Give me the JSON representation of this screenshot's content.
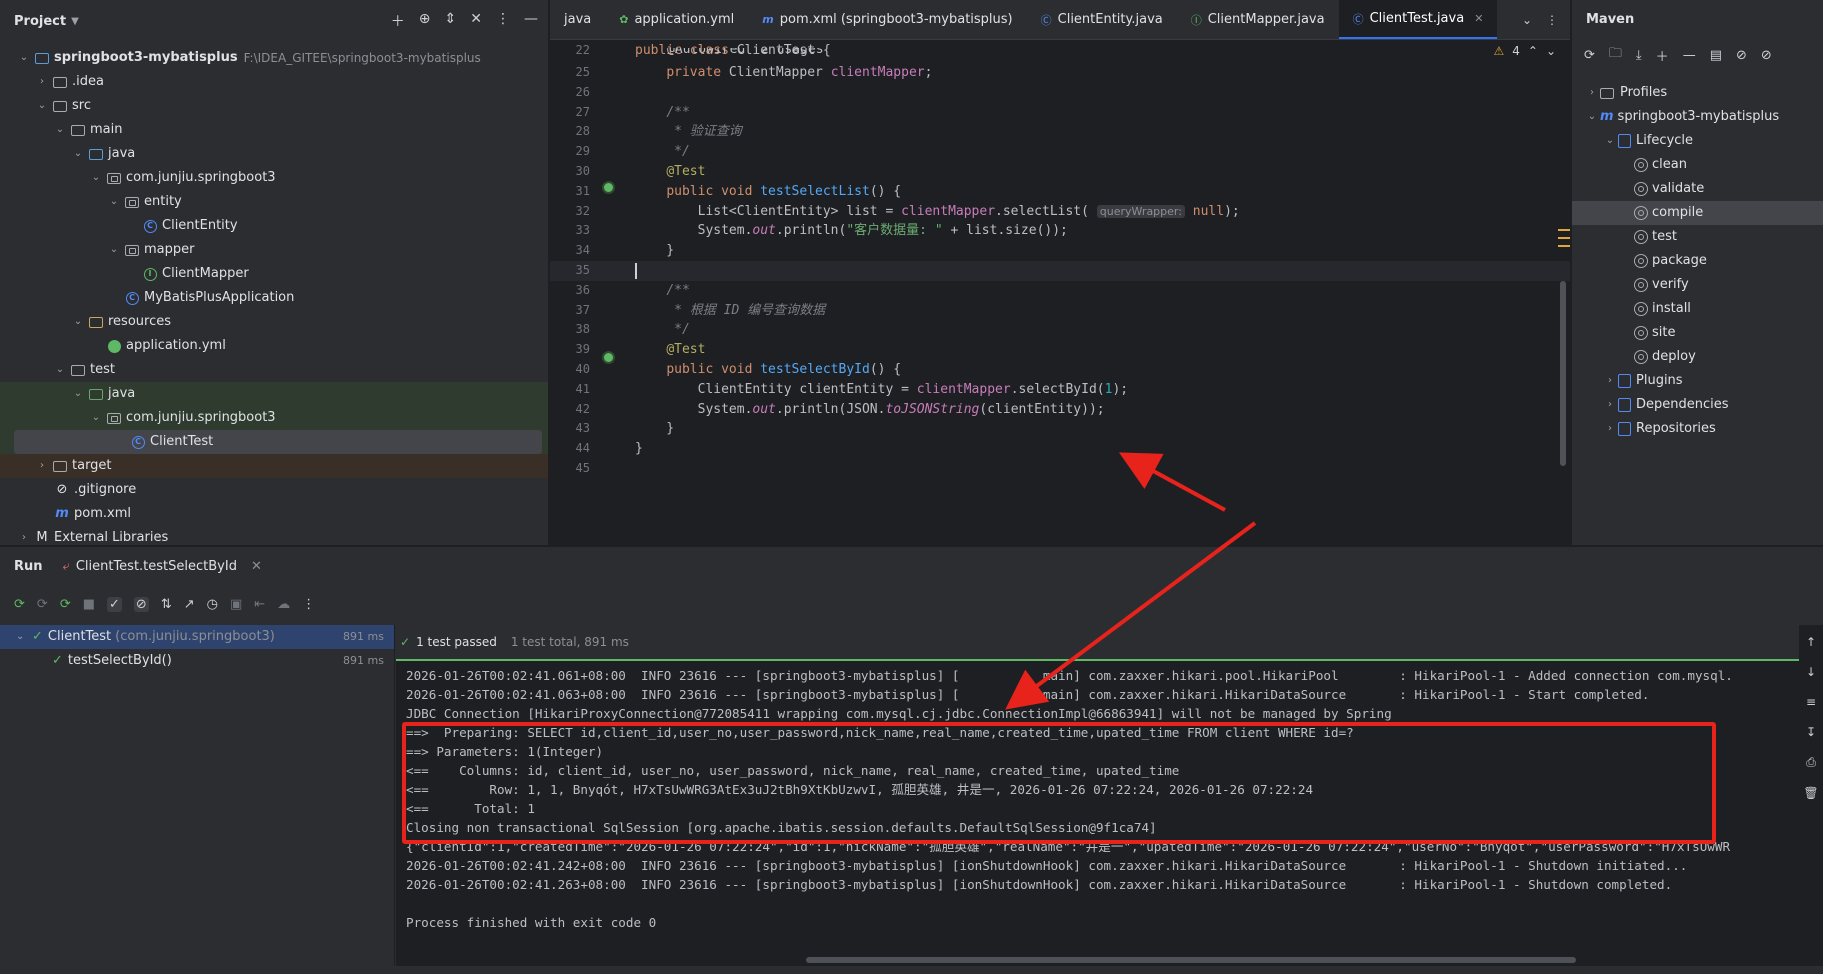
{
  "project": {
    "title": "Project",
    "tree": [
      {
        "label": "springboot3-mybatisplus",
        "path": "F:\\IDEA_GITEE\\springboot3-mybatisplus"
      },
      {
        "label": ".idea"
      },
      {
        "label": "src"
      },
      {
        "label": "main"
      },
      {
        "label": "java"
      },
      {
        "label": "com.junjiu.springboot3"
      },
      {
        "label": "entity"
      },
      {
        "label": "ClientEntity"
      },
      {
        "label": "mapper"
      },
      {
        "label": "ClientMapper"
      },
      {
        "label": "MyBatisPlusApplication"
      },
      {
        "label": "resources"
      },
      {
        "label": "application.yml"
      },
      {
        "label": "test"
      },
      {
        "label": "java"
      },
      {
        "label": "com.junjiu.springboot3"
      },
      {
        "label": "ClientTest"
      },
      {
        "label": "target"
      },
      {
        "label": ".gitignore"
      },
      {
        "label": "pom.xml"
      },
      {
        "label": "External Libraries"
      }
    ]
  },
  "editor": {
    "tabs": [
      {
        "label": "java"
      },
      {
        "label": "application.yml"
      },
      {
        "label": "pom.xml (springboot3-mybatisplus)"
      },
      {
        "label": "ClientEntity.java"
      },
      {
        "label": "ClientMapper.java"
      },
      {
        "label": "ClientTest.java"
      }
    ],
    "warning_count": "4",
    "lines": [
      {
        "n": "22",
        "html": "<span class=\"kw\">public class</span> ClientTest {"
      },
      {
        "n": "25",
        "html": "    <span class=\"kw\">private</span> ClientMapper <span class=\"fld\">clientMapper</span>;"
      },
      {
        "n": "26",
        "html": ""
      },
      {
        "n": "27",
        "html": "    <span class=\"cm\">/**</span>"
      },
      {
        "n": "28",
        "html": "    <span class=\"cm\"> * 验证查询</span>"
      },
      {
        "n": "29",
        "html": "    <span class=\"cm\"> */</span>"
      },
      {
        "n": "30",
        "html": "    <span class=\"an\">@Test</span>"
      },
      {
        "n": "31",
        "html": "    <span class=\"kw\">public void</span> <span class=\"fn\">testSelectList</span>() {"
      },
      {
        "n": "32",
        "html": "        List&lt;ClientEntity&gt; list = <span class=\"fld\">clientMapper</span>.selectList( <span class=\"hint\">queryWrapper:</span> <span class=\"kw\">null</span>);"
      },
      {
        "n": "33",
        "html": "        System.<span class=\"it\">out</span>.println(<span class=\"st\">\"客户数据量: \"</span> + list.size());"
      },
      {
        "n": "34",
        "html": "    }"
      },
      {
        "n": "35",
        "html": ""
      },
      {
        "n": "36",
        "html": "    <span class=\"cm\">/**</span>"
      },
      {
        "n": "37",
        "html": "    <span class=\"cm\"> * 根据 ID 编号查询数据</span>"
      },
      {
        "n": "38",
        "html": "    <span class=\"cm\"> */</span>"
      },
      {
        "n": "39",
        "html": "    <span class=\"an\">@Test</span>"
      },
      {
        "n": "40",
        "html": "    <span class=\"kw\">public void</span> <span class=\"fn\">testSelectById</span>() {"
      },
      {
        "n": "41",
        "html": "        ClientEntity clientEntity = <span class=\"fld\">clientMapper</span>.selectById(<span class=\"num\">1</span>);"
      },
      {
        "n": "42",
        "html": "        System.<span class=\"it\">out</span>.println(JSON.<span class=\"it\">toJSONString</span>(clientEntity));"
      },
      {
        "n": "43",
        "html": "    }"
      },
      {
        "n": "44",
        "html": "}"
      },
      {
        "n": "45",
        "html": ""
      }
    ],
    "autowired_hint": "@Autowired  2 usages"
  },
  "maven": {
    "title": "Maven",
    "tree": [
      {
        "label": "Profiles"
      },
      {
        "label": "springboot3-mybatisplus"
      },
      {
        "label": "Lifecycle"
      },
      {
        "label": "clean"
      },
      {
        "label": "validate"
      },
      {
        "label": "compile"
      },
      {
        "label": "test"
      },
      {
        "label": "package"
      },
      {
        "label": "verify"
      },
      {
        "label": "install"
      },
      {
        "label": "site"
      },
      {
        "label": "deploy"
      },
      {
        "label": "Plugins"
      },
      {
        "label": "Dependencies"
      },
      {
        "label": "Repositories"
      }
    ]
  },
  "run": {
    "title": "Run",
    "tab_label": "ClientTest.testSelectById",
    "tests": [
      {
        "name": "ClientTest",
        "pkg": "(com.junjiu.springboot3)",
        "duration": "891 ms"
      },
      {
        "name": "testSelectById()",
        "duration": "891 ms"
      }
    ],
    "status": "1 test passed",
    "status_sub": "1 test total, 891 ms",
    "console": [
      "2026-01-26T00:02:41.061+08:00  INFO 23616 --- [springboot3-mybatisplus] [           main] com.zaxxer.hikari.pool.HikariPool        : HikariPool-1 - Added connection com.mysql.",
      "2026-01-26T00:02:41.063+08:00  INFO 23616 --- [springboot3-mybatisplus] [           main] com.zaxxer.hikari.HikariDataSource       : HikariPool-1 - Start completed.",
      "JDBC Connection [HikariProxyConnection@772085411 wrapping com.mysql.cj.jdbc.ConnectionImpl@66863941] will not be managed by Spring",
      "==>  Preparing: SELECT id,client_id,user_no,user_password,nick_name,real_name,created_time,upated_time FROM client WHERE id=?",
      "==> Parameters: 1(Integer)",
      "<==    Columns: id, client_id, user_no, user_password, nick_name, real_name, created_time, upated_time",
      "<==        Row: 1, 1, Bnyqót, H7xTsUwWRG3AtEx3uJ2tBh9XtKbUzwvI, 孤胆英雄, 井是一, 2026-01-26 07:22:24, 2026-01-26 07:22:24",
      "<==      Total: 1",
      "Closing non transactional SqlSession [org.apache.ibatis.session.defaults.DefaultSqlSession@9f1ca74]",
      "{\"clientId\":1,\"createdTime\":\"2026-01-26 07:22:24\",\"id\":1,\"nickName\":\"孤胆英雄\",\"realName\":\"井是一\",\"upatedTime\":\"2026-01-26 07:22:24\",\"userNo\":\"Bnyqót\",\"userPassword\":\"H7xTsUwWR",
      "2026-01-26T00:02:41.242+08:00  INFO 23616 --- [springboot3-mybatisplus] [ionShutdownHook] com.zaxxer.hikari.HikariDataSource       : HikariPool-1 - Shutdown initiated...",
      "2026-01-26T00:02:41.263+08:00  INFO 23616 --- [springboot3-mybatisplus] [ionShutdownHook] com.zaxxer.hikari.HikariDataSource       : HikariPool-1 - Shutdown completed.",
      "",
      "Process finished with exit code 0"
    ]
  },
  "colors": {
    "accent": "#3574f0",
    "annotation_red": "#e8231b",
    "pass_green": "#5fb865"
  }
}
